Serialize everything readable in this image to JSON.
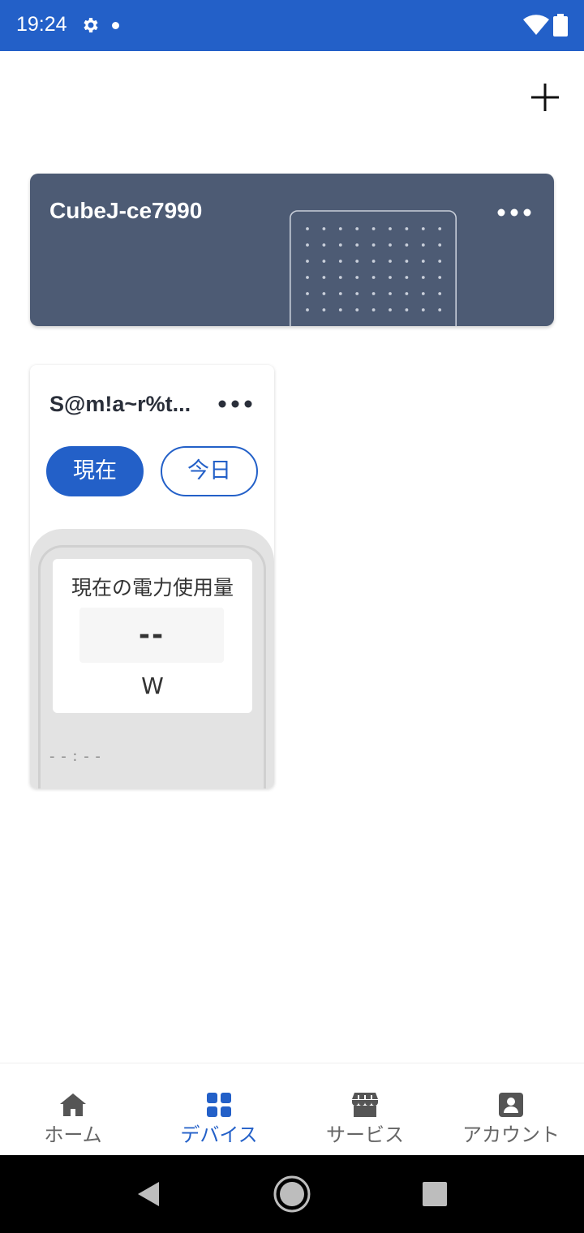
{
  "status_bar": {
    "time": "19:24",
    "icons": [
      "gear-icon",
      "notification-dot",
      "wifi-icon",
      "battery-icon"
    ]
  },
  "header": {
    "add_icon": "plus-icon"
  },
  "device_card": {
    "name": "CubeJ-ce7990",
    "more_icon": "more-horizontal-icon",
    "bg_color": "#4d5b74"
  },
  "meter_card": {
    "name": "S@m!a~r%t...",
    "more_icon": "more-horizontal-icon",
    "tabs": [
      {
        "label": "現在",
        "selected": true
      },
      {
        "label": "今日",
        "selected": false
      }
    ],
    "reading": {
      "label": "現在の電力使用量",
      "value": "--",
      "unit": "W",
      "time": "- - : - -"
    }
  },
  "bottom_nav": {
    "items": [
      {
        "label": "ホーム",
        "icon": "home-icon",
        "active": false
      },
      {
        "label": "デバイス",
        "icon": "devices-grid-icon",
        "active": true
      },
      {
        "label": "サービス",
        "icon": "store-icon",
        "active": false
      },
      {
        "label": "アカウント",
        "icon": "account-icon",
        "active": false
      }
    ]
  },
  "colors": {
    "accent": "#2360c8",
    "status_bar": "#2360c8",
    "nav_inactive": "#666666"
  }
}
